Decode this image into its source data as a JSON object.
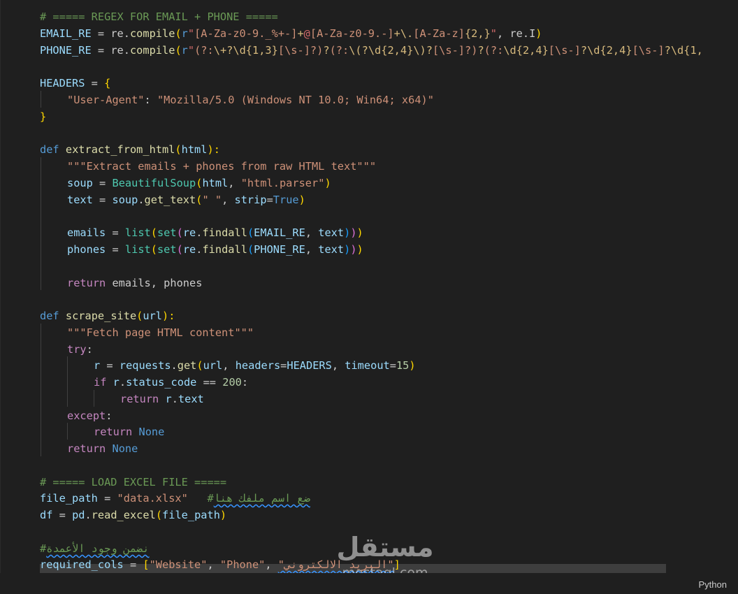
{
  "code": {
    "l1": {
      "t0": "# ===== REGEX FOR EMAIL + PHONE ====="
    },
    "l2": {
      "t0": "EMAIL_RE",
      "t1": " = ",
      "t2": "re",
      "t3": ".",
      "t4": "compile",
      "t5": "(",
      "t6": "r",
      "t7": "\"",
      "t8": "[A-Za-z0-9._%+-]",
      "t9": "+",
      "t10": "@",
      "t11": "[A-Za-z0-9.-]",
      "t12": "+",
      "t13": "\\.",
      "t14": "[A-Za-z]",
      "t15": "{2,}",
      "t16": "\"",
      "t17": ", ",
      "t18": "re",
      "t19": ".",
      "t20": "I",
      "t21": ")"
    },
    "l3": {
      "t0": "PHONE_RE",
      "t1": " = ",
      "t2": "re",
      "t3": ".",
      "t4": "compile",
      "t5": "(",
      "t6": "r",
      "t7": "\"",
      "t8": "(?:",
      "t9": "\\+",
      "t10": "?",
      "t11": "\\d",
      "t12": "{1,3}",
      "t13": "[\\s-]",
      "t14": "?)",
      "t15": "?",
      "t16": "(?:",
      "t17": "\\(",
      "t18": "?",
      "t19": "\\d",
      "t20": "{2,4}",
      "t21": "\\)",
      "t22": "?",
      "t23": "[\\s-]",
      "t24": "?)",
      "t25": "?",
      "t26": "(?:",
      "t27": "\\d",
      "t28": "{2,4}",
      "t29": "[\\s-]",
      "t30": "?",
      "t31": "\\d",
      "t32": "{2,4}",
      "t33": "[\\s-]",
      "t34": "?",
      "t35": "\\d",
      "t36": "{1,"
    },
    "l5": {
      "t0": "HEADERS",
      "t1": " = ",
      "t2": "{"
    },
    "l6": {
      "t0": "\"User-Agent\"",
      "t1": ": ",
      "t2": "\"Mozilla/5.0 (Windows NT 10.0; Win64; x64)\""
    },
    "l7": {
      "t0": "}"
    },
    "l9": {
      "t0": "def",
      "t1": " ",
      "t2": "extract_from_html",
      "t3": "(",
      "t4": "html",
      "t5": "):"
    },
    "l10": {
      "t0": "\"\"\"Extract emails + phones from raw HTML text\"\"\""
    },
    "l11": {
      "t0": "soup",
      "t1": " = ",
      "t2": "BeautifulSoup",
      "t3": "(",
      "t4": "html",
      "t5": ", ",
      "t6": "\"html.parser\"",
      "t7": ")"
    },
    "l12": {
      "t0": "text",
      "t1": " = ",
      "t2": "soup",
      "t3": ".",
      "t4": "get_text",
      "t5": "(",
      "t6": "\" \"",
      "t7": ", ",
      "t8": "strip",
      "t9": "=",
      "t10": "True",
      "t11": ")"
    },
    "l14": {
      "t0": "emails",
      "t1": " = ",
      "t2": "list",
      "t3": "(",
      "t4": "set",
      "t5": "(",
      "t6": "re",
      "t7": ".",
      "t8": "findall",
      "t9": "(",
      "t10": "EMAIL_RE",
      "t11": ", ",
      "t12": "text",
      "t13": ")",
      "t14": ")",
      "t15": ")"
    },
    "l15": {
      "t0": "phones",
      "t1": " = ",
      "t2": "list",
      "t3": "(",
      "t4": "set",
      "t5": "(",
      "t6": "re",
      "t7": ".",
      "t8": "findall",
      "t9": "(",
      "t10": "PHONE_RE",
      "t11": ", ",
      "t12": "text",
      "t13": ")",
      "t14": ")",
      "t15": ")"
    },
    "l17": {
      "t0": "return",
      "t1": " emails, phones"
    },
    "l19": {
      "t0": "def",
      "t1": " ",
      "t2": "scrape_site",
      "t3": "(",
      "t4": "url",
      "t5": "):"
    },
    "l20": {
      "t0": "\"\"\"Fetch page HTML content\"\"\""
    },
    "l21": {
      "t0": "try",
      "t1": ":"
    },
    "l22": {
      "t0": "r",
      "t1": " = ",
      "t2": "requests",
      "t3": ".",
      "t4": "get",
      "t5": "(",
      "t6": "url",
      "t7": ", ",
      "t8": "headers",
      "t9": "=",
      "t10": "HEADERS",
      "t11": ", ",
      "t12": "timeout",
      "t13": "=",
      "t14": "15",
      "t15": ")"
    },
    "l23": {
      "t0": "if",
      "t1": " ",
      "t2": "r",
      "t3": ".",
      "t4": "status_code",
      "t5": " == ",
      "t6": "200",
      "t7": ":"
    },
    "l24": {
      "t0": "return",
      "t1": " ",
      "t2": "r",
      "t3": ".",
      "t4": "text"
    },
    "l25": {
      "t0": "except",
      "t1": ":"
    },
    "l26": {
      "t0": "return",
      "t1": " ",
      "t2": "None"
    },
    "l27": {
      "t0": "return",
      "t1": " ",
      "t2": "None"
    },
    "l29": {
      "t0": "# ===== LOAD EXCEL FILE ====="
    },
    "l30": {
      "t0": "file_path",
      "t1": " = ",
      "t2": "\"data.xlsx\"",
      "t3": "   #",
      "t4": "ضع اسم ملفك هنا"
    },
    "l31": {
      "t0": "df",
      "t1": " = ",
      "t2": "pd",
      "t3": ".",
      "t4": "read_excel",
      "t5": "(",
      "t6": "file_path",
      "t7": ")"
    },
    "l33": {
      "t0": "#",
      "t1": "نضمن وجود الأعمدة"
    },
    "l34": {
      "t0": "required_cols",
      "t1": " = ",
      "t2": "[",
      "t3": "\"Website\"",
      "t4": ", ",
      "t5": "\"Phone\"",
      "t6": ", ",
      "t7": "\"البريد الالكتروني\"",
      "t8": "]"
    }
  },
  "status_bar": {
    "language": "Python"
  },
  "watermark": {
    "brand": "مستقل",
    "domain": "mostaql.com"
  },
  "colors": {
    "background": "#1f1f1f",
    "keyword": "#c586c0",
    "string": "#ce9178",
    "comment": "#6a9955",
    "variable": "#9cdcfe",
    "function": "#dcdcaa"
  }
}
